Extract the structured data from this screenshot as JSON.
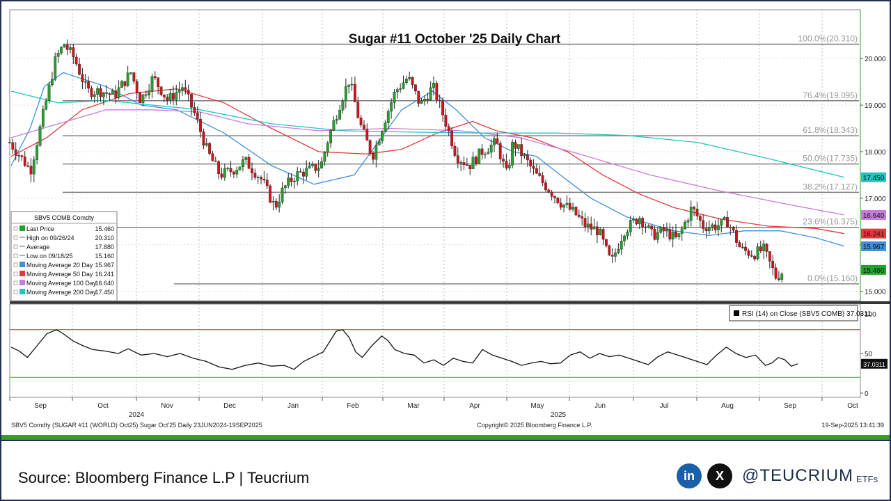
{
  "chart_data": {
    "type": "candlestick",
    "title": "Sugar #11 October '25 Daily Chart",
    "x_labels": [
      "Sep",
      "Oct",
      "Nov",
      "Dec",
      "Jan",
      "Feb",
      "Mar",
      "Apr",
      "May",
      "Jun",
      "Jul",
      "Aug",
      "Sep",
      "Oct"
    ],
    "year_labels": [
      {
        "label": "2024",
        "month": "Oct"
      },
      {
        "label": "2025",
        "month": "May"
      }
    ],
    "price_axis": {
      "ticks": [
        "20.000",
        "19.000",
        "18.000",
        "17.000",
        "16.000",
        "15.000"
      ],
      "ylim": [
        14.8,
        21.05
      ]
    },
    "fib_levels": [
      {
        "label": "100.0%(20.310)",
        "value": 20.31
      },
      {
        "label": "76.4%(19.095)",
        "value": 19.095
      },
      {
        "label": "61.8%(18.343)",
        "value": 18.343
      },
      {
        "label": "50.0%(17.735)",
        "value": 17.735
      },
      {
        "label": "38.2%(17.127)",
        "value": 17.127
      },
      {
        "label": "23.6%(16.375)",
        "value": 16.375
      },
      {
        "label": "0.0%(15.160)",
        "value": 15.16
      }
    ],
    "price_tags": [
      {
        "label": "17.450",
        "value": 17.45,
        "color": "#27c1c1"
      },
      {
        "label": "16.640",
        "value": 16.64,
        "color": "#c77bdb"
      },
      {
        "label": "16.241",
        "value": 16.241,
        "color": "#e23a3a"
      },
      {
        "label": "15.967",
        "value": 15.967,
        "color": "#3d8fe0"
      },
      {
        "label": "15.460",
        "value": 15.46,
        "color": "#22a12c"
      }
    ],
    "close_series": [
      {
        "month": "Sep",
        "day": 0,
        "value": 18.2
      },
      {
        "month": "Sep",
        "day": 10,
        "value": 17.6
      },
      {
        "month": "Sep",
        "day": 16,
        "value": 18.8
      },
      {
        "month": "Sep",
        "day": 22,
        "value": 20.0
      },
      {
        "month": "Sep",
        "day": 26,
        "value": 20.31
      },
      {
        "month": "Oct",
        "day": 1,
        "value": 20.0
      },
      {
        "month": "Oct",
        "day": 7,
        "value": 19.3
      },
      {
        "month": "Oct",
        "day": 14,
        "value": 19.3
      },
      {
        "month": "Oct",
        "day": 20,
        "value": 19.2
      },
      {
        "month": "Oct",
        "day": 28,
        "value": 19.7
      },
      {
        "month": "Nov",
        "day": 2,
        "value": 19.1
      },
      {
        "month": "Nov",
        "day": 8,
        "value": 19.6
      },
      {
        "month": "Nov",
        "day": 15,
        "value": 19.1
      },
      {
        "month": "Nov",
        "day": 22,
        "value": 19.4
      },
      {
        "month": "Nov",
        "day": 28,
        "value": 18.8
      },
      {
        "month": "Dec",
        "day": 4,
        "value": 18.0
      },
      {
        "month": "Dec",
        "day": 10,
        "value": 17.5
      },
      {
        "month": "Dec",
        "day": 16,
        "value": 17.6
      },
      {
        "month": "Dec",
        "day": 22,
        "value": 17.8
      },
      {
        "month": "Dec",
        "day": 30,
        "value": 17.4
      },
      {
        "month": "Jan",
        "day": 6,
        "value": 16.8
      },
      {
        "month": "Jan",
        "day": 10,
        "value": 17.2
      },
      {
        "month": "Jan",
        "day": 16,
        "value": 17.5
      },
      {
        "month": "Jan",
        "day": 22,
        "value": 17.6
      },
      {
        "month": "Jan",
        "day": 28,
        "value": 17.7
      },
      {
        "month": "Feb",
        "day": 3,
        "value": 18.3
      },
      {
        "month": "Feb",
        "day": 9,
        "value": 19.1
      },
      {
        "month": "Feb",
        "day": 13,
        "value": 19.55
      },
      {
        "month": "Feb",
        "day": 18,
        "value": 18.6
      },
      {
        "month": "Feb",
        "day": 24,
        "value": 17.9
      },
      {
        "month": "Mar",
        "day": 1,
        "value": 18.7
      },
      {
        "month": "Mar",
        "day": 6,
        "value": 19.3
      },
      {
        "month": "Mar",
        "day": 12,
        "value": 19.6
      },
      {
        "month": "Mar",
        "day": 18,
        "value": 19.0
      },
      {
        "month": "Mar",
        "day": 24,
        "value": 19.4
      },
      {
        "month": "Apr",
        "day": 1,
        "value": 18.6
      },
      {
        "month": "Apr",
        "day": 6,
        "value": 17.9
      },
      {
        "month": "Apr",
        "day": 12,
        "value": 17.7
      },
      {
        "month": "Apr",
        "day": 18,
        "value": 18.0
      },
      {
        "month": "Apr",
        "day": 25,
        "value": 18.2
      },
      {
        "month": "Apr",
        "day": 30,
        "value": 17.5
      },
      {
        "month": "May",
        "day": 3,
        "value": 18.2
      },
      {
        "month": "May",
        "day": 8,
        "value": 17.9
      },
      {
        "month": "May",
        "day": 14,
        "value": 17.5
      },
      {
        "month": "May",
        "day": 20,
        "value": 17.2
      },
      {
        "month": "May",
        "day": 26,
        "value": 16.9
      },
      {
        "month": "Jun",
        "day": 2,
        "value": 16.7
      },
      {
        "month": "Jun",
        "day": 8,
        "value": 16.4
      },
      {
        "month": "Jun",
        "day": 14,
        "value": 16.3
      },
      {
        "month": "Jun",
        "day": 20,
        "value": 15.6
      },
      {
        "month": "Jun",
        "day": 26,
        "value": 16.3
      },
      {
        "month": "Jul",
        "day": 3,
        "value": 16.6
      },
      {
        "month": "Jul",
        "day": 9,
        "value": 16.2
      },
      {
        "month": "Jul",
        "day": 15,
        "value": 16.3
      },
      {
        "month": "Jul",
        "day": 21,
        "value": 16.1
      },
      {
        "month": "Jul",
        "day": 28,
        "value": 16.8
      },
      {
        "month": "Aug",
        "day": 3,
        "value": 16.4
      },
      {
        "month": "Aug",
        "day": 9,
        "value": 16.4
      },
      {
        "month": "Aug",
        "day": 15,
        "value": 16.5
      },
      {
        "month": "Aug",
        "day": 21,
        "value": 15.9
      },
      {
        "month": "Aug",
        "day": 27,
        "value": 15.8
      },
      {
        "month": "Sep",
        "day": 2,
        "value": 15.9
      },
      {
        "month": "Sep",
        "day": 8,
        "value": 15.3
      },
      {
        "month": "Sep",
        "day": 12,
        "value": 15.46
      }
    ],
    "ma_series": [
      {
        "label": "Moving Average 20 Day",
        "color": "#3d8fe0",
        "points": [
          [
            0,
            17.7
          ],
          [
            8,
            18.5
          ],
          [
            14,
            19.4
          ],
          [
            22,
            19.7
          ],
          [
            40,
            19.4
          ],
          [
            55,
            19.0
          ],
          [
            70,
            18.9
          ],
          [
            90,
            18.4
          ],
          [
            110,
            17.7
          ],
          [
            128,
            17.3
          ],
          [
            145,
            17.5
          ],
          [
            155,
            18.2
          ],
          [
            165,
            18.9
          ],
          [
            178,
            19.3
          ],
          [
            188,
            18.9
          ],
          [
            200,
            18.3
          ],
          [
            212,
            18.0
          ],
          [
            222,
            17.9
          ],
          [
            232,
            17.5
          ],
          [
            245,
            17.0
          ],
          [
            260,
            16.6
          ],
          [
            280,
            16.3
          ],
          [
            295,
            16.2
          ],
          [
            310,
            16.3
          ],
          [
            325,
            16.3
          ],
          [
            340,
            16.15
          ],
          [
            352,
            15.97
          ]
        ]
      },
      {
        "label": "Moving Average 50 Day",
        "color": "#e23a3a",
        "points": [
          [
            0,
            17.9
          ],
          [
            15,
            18.3
          ],
          [
            30,
            18.9
          ],
          [
            50,
            19.25
          ],
          [
            70,
            19.35
          ],
          [
            90,
            19.05
          ],
          [
            110,
            18.5
          ],
          [
            130,
            18.0
          ],
          [
            150,
            17.95
          ],
          [
            165,
            18.05
          ],
          [
            180,
            18.4
          ],
          [
            195,
            18.65
          ],
          [
            205,
            18.45
          ],
          [
            220,
            18.3
          ],
          [
            235,
            18.0
          ],
          [
            250,
            17.5
          ],
          [
            265,
            17.1
          ],
          [
            280,
            16.8
          ],
          [
            300,
            16.55
          ],
          [
            320,
            16.4
          ],
          [
            340,
            16.35
          ],
          [
            352,
            16.24
          ]
        ]
      },
      {
        "label": "Moving Average 100 Day",
        "color": "#c77bdb",
        "points": [
          [
            0,
            18.3
          ],
          [
            20,
            18.6
          ],
          [
            40,
            18.9
          ],
          [
            60,
            18.9
          ],
          [
            80,
            18.85
          ],
          [
            100,
            18.6
          ],
          [
            130,
            18.45
          ],
          [
            160,
            18.5
          ],
          [
            190,
            18.45
          ],
          [
            215,
            18.3
          ],
          [
            240,
            17.95
          ],
          [
            270,
            17.5
          ],
          [
            300,
            17.15
          ],
          [
            330,
            16.85
          ],
          [
            352,
            16.64
          ]
        ]
      },
      {
        "label": "Moving Average 200 Day",
        "color": "#27c1c1",
        "points": [
          [
            0,
            19.3
          ],
          [
            20,
            19.05
          ],
          [
            40,
            19.1
          ],
          [
            60,
            19.0
          ],
          [
            80,
            18.9
          ],
          [
            110,
            18.6
          ],
          [
            140,
            18.45
          ],
          [
            170,
            18.42
          ],
          [
            200,
            18.4
          ],
          [
            230,
            18.4
          ],
          [
            260,
            18.35
          ],
          [
            290,
            18.2
          ],
          [
            320,
            17.85
          ],
          [
            352,
            17.45
          ]
        ]
      }
    ],
    "legend": {
      "header": "SBV5 COMB Comdty",
      "rows": [
        {
          "label": "Last Price",
          "value": "15.460",
          "color": "#22a12c"
        },
        {
          "label": "High on 09/26/24",
          "value": "20.310",
          "color": ""
        },
        {
          "label": "Average",
          "value": "17.880",
          "color": ""
        },
        {
          "label": "Low on 09/18/25",
          "value": "15.160",
          "color": ""
        },
        {
          "label": "Moving Average 20 Day",
          "value": "15.967",
          "color": "#3d8fe0"
        },
        {
          "label": "Moving Average 50 Day",
          "value": "16.241",
          "color": "#e23a3a"
        },
        {
          "label": "Moving Average 100 Day",
          "value": "16.640",
          "color": "#c77bdb"
        },
        {
          "label": "Moving Average 200 Day",
          "value": "17.450",
          "color": "#27c1c1"
        }
      ]
    },
    "rsi": {
      "label": "RSI (14)  on Close (SBV5 COMB) 37.0311",
      "value_tag": "37.0311",
      "ticks": [
        "100",
        "50",
        "0"
      ],
      "upper": 80,
      "lower": 20,
      "points": [
        [
          0,
          58
        ],
        [
          5,
          53
        ],
        [
          10,
          45
        ],
        [
          16,
          60
        ],
        [
          22,
          75
        ],
        [
          28,
          80
        ],
        [
          32,
          75
        ],
        [
          38,
          66
        ],
        [
          44,
          60
        ],
        [
          50,
          55
        ],
        [
          58,
          53
        ],
        [
          66,
          50
        ],
        [
          72,
          56
        ],
        [
          80,
          48
        ],
        [
          88,
          50
        ],
        [
          96,
          46
        ],
        [
          104,
          50
        ],
        [
          112,
          44
        ],
        [
          120,
          40
        ],
        [
          128,
          33
        ],
        [
          136,
          30
        ],
        [
          144,
          35
        ],
        [
          152,
          38
        ],
        [
          160,
          34
        ],
        [
          168,
          35
        ],
        [
          174,
          30
        ],
        [
          180,
          40
        ],
        [
          186,
          46
        ],
        [
          192,
          52
        ],
        [
          196,
          65
        ],
        [
          200,
          78
        ],
        [
          204,
          80
        ],
        [
          208,
          70
        ],
        [
          212,
          52
        ],
        [
          216,
          45
        ],
        [
          222,
          60
        ],
        [
          228,
          72
        ],
        [
          232,
          66
        ],
        [
          236,
          55
        ],
        [
          242,
          50
        ],
        [
          248,
          48
        ],
        [
          254,
          38
        ],
        [
          260,
          42
        ],
        [
          266,
          35
        ],
        [
          272,
          44
        ],
        [
          278,
          40
        ],
        [
          284,
          38
        ],
        [
          290,
          55
        ],
        [
          296,
          48
        ],
        [
          302,
          44
        ],
        [
          308,
          40
        ],
        [
          314,
          35
        ],
        [
          320,
          38
        ],
        [
          326,
          40
        ],
        [
          332,
          37
        ],
        [
          338,
          38
        ],
        [
          344,
          48
        ],
        [
          350,
          52
        ],
        [
          356,
          44
        ],
        [
          362,
          50
        ],
        [
          368,
          46
        ],
        [
          374,
          48
        ],
        [
          380,
          44
        ],
        [
          386,
          40
        ],
        [
          392,
          36
        ],
        [
          398,
          46
        ],
        [
          404,
          52
        ],
        [
          410,
          48
        ],
        [
          416,
          44
        ],
        [
          422,
          40
        ],
        [
          428,
          36
        ],
        [
          434,
          48
        ],
        [
          440,
          58
        ],
        [
          446,
          50
        ],
        [
          452,
          45
        ],
        [
          458,
          48
        ],
        [
          464,
          35
        ],
        [
          468,
          38
        ],
        [
          472,
          45
        ],
        [
          476,
          42
        ],
        [
          480,
          34
        ],
        [
          484,
          37
        ]
      ]
    },
    "footer_left": "SBV5 Comdty (SUGAR #11 (WORLD) Oct25) Sugar Oct'25  Daily 23JUN2024-19SEP2025",
    "footer_center": "Copyright© 2025 Bloomberg Finance L.P.",
    "footer_right": "19-Sep-2025 13:41:39"
  },
  "source": "Source: Bloomberg Finance L.P | Teucrium",
  "brand": {
    "handle": "@TEUCRIUM",
    "suffix": "ETFs",
    "linkedin": "in",
    "x": "X"
  }
}
